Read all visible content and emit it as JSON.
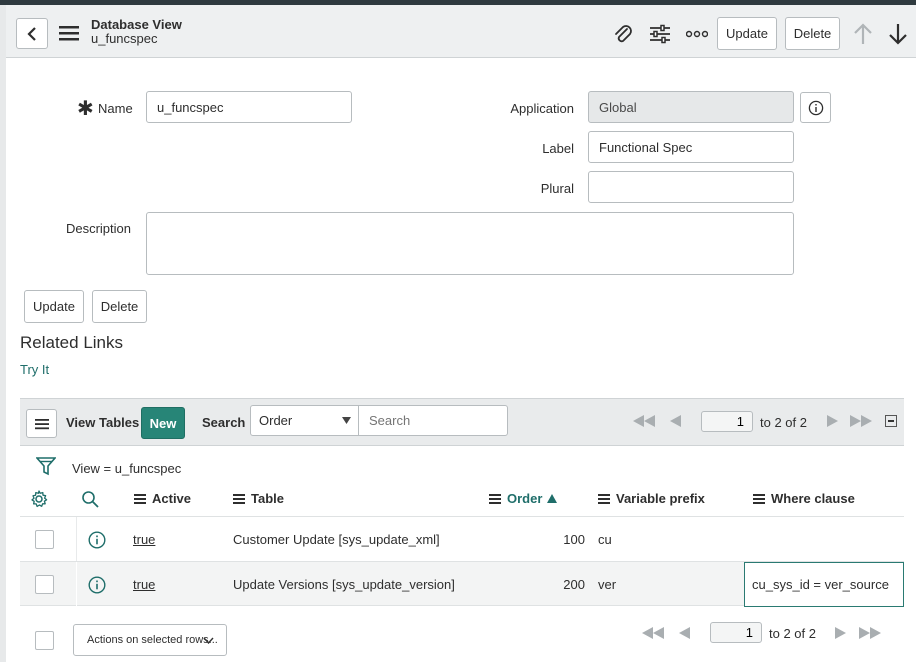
{
  "header": {
    "title": "Database View",
    "subtitle": "u_funcspec",
    "update_label": "Update",
    "delete_label": "Delete"
  },
  "form": {
    "name_label": "Name",
    "name_value": "u_funcspec",
    "application_label": "Application",
    "application_value": "Global",
    "label_label": "Label",
    "label_value": "Functional Spec",
    "plural_label": "Plural",
    "plural_value": "",
    "description_label": "Description",
    "description_value": "",
    "update_label": "Update",
    "delete_label": "Delete"
  },
  "related_links": {
    "title": "Related Links",
    "items": [
      "Try It"
    ]
  },
  "list": {
    "title": "View Tables",
    "new_label": "New",
    "search_label": "Search",
    "search_field_selected": "Order",
    "search_placeholder": "Search",
    "page_value": "1",
    "page_range": "to 2 of 2",
    "filter_text": "View = u_funcspec",
    "columns": [
      "Active",
      "Table",
      "Order",
      "Variable prefix",
      "Where clause"
    ],
    "rows": [
      {
        "active": "true",
        "table": "Customer Update [sys_update_xml]",
        "order": "100",
        "prefix": "cu",
        "where": ""
      },
      {
        "active": "true",
        "table": "Update Versions [sys_update_version]",
        "order": "200",
        "prefix": "ver",
        "where": "cu_sys_id = ver_source"
      }
    ],
    "actions_label": "Actions on selected rows...",
    "footer_page_value": "1",
    "footer_page_range": "to 2 of 2"
  },
  "colors": {
    "accent": "#1f6e6a",
    "new_button": "#278577",
    "header_bg": "#eef0f1"
  }
}
